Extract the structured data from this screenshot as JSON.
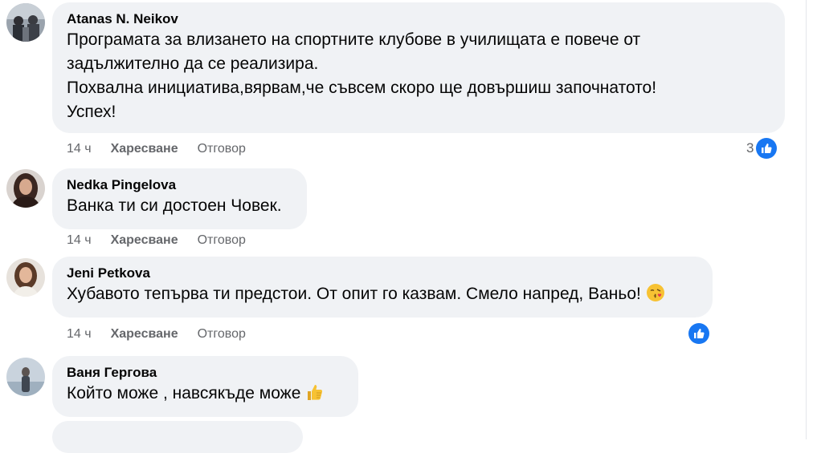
{
  "comments": [
    {
      "author": "Atanas N. Neikov",
      "lines": [
        "Програмата за влизането на спортните клубове в училищата е повече от",
        "задължително да се реализира.",
        "Похвална инициатива,вярвам,че съвсем скоро ще довършиш започнатото!",
        "Успех!"
      ],
      "time": "14 ч",
      "like_label": "Харесване",
      "reply_label": "Отговор",
      "reaction_count": "3",
      "reaction_icon": "like-icon"
    },
    {
      "author": "Nedka Pingelova",
      "lines": [
        "Ванка ти си достоен Човек."
      ],
      "time": "14 ч",
      "like_label": "Харесване",
      "reply_label": "Отговор"
    },
    {
      "author": "Jeni Petkova",
      "lines": [
        "Хубавото тепърва ти предстои. От опит го казвам. Смело напред, Ваньо!"
      ],
      "emoji": "face-blowing-kiss-emoji",
      "time": "14 ч",
      "like_label": "Харесване",
      "reply_label": "Отговор",
      "reaction_icon": "like-icon"
    },
    {
      "author": "Ваня Гергова",
      "lines": [
        "Който може , навсякъде може"
      ],
      "emoji": "thumbs-up-emoji"
    }
  ],
  "colors": {
    "bubble": "#f0f2f5",
    "meta_text": "#65676b",
    "like_blue": "#1877f2"
  }
}
